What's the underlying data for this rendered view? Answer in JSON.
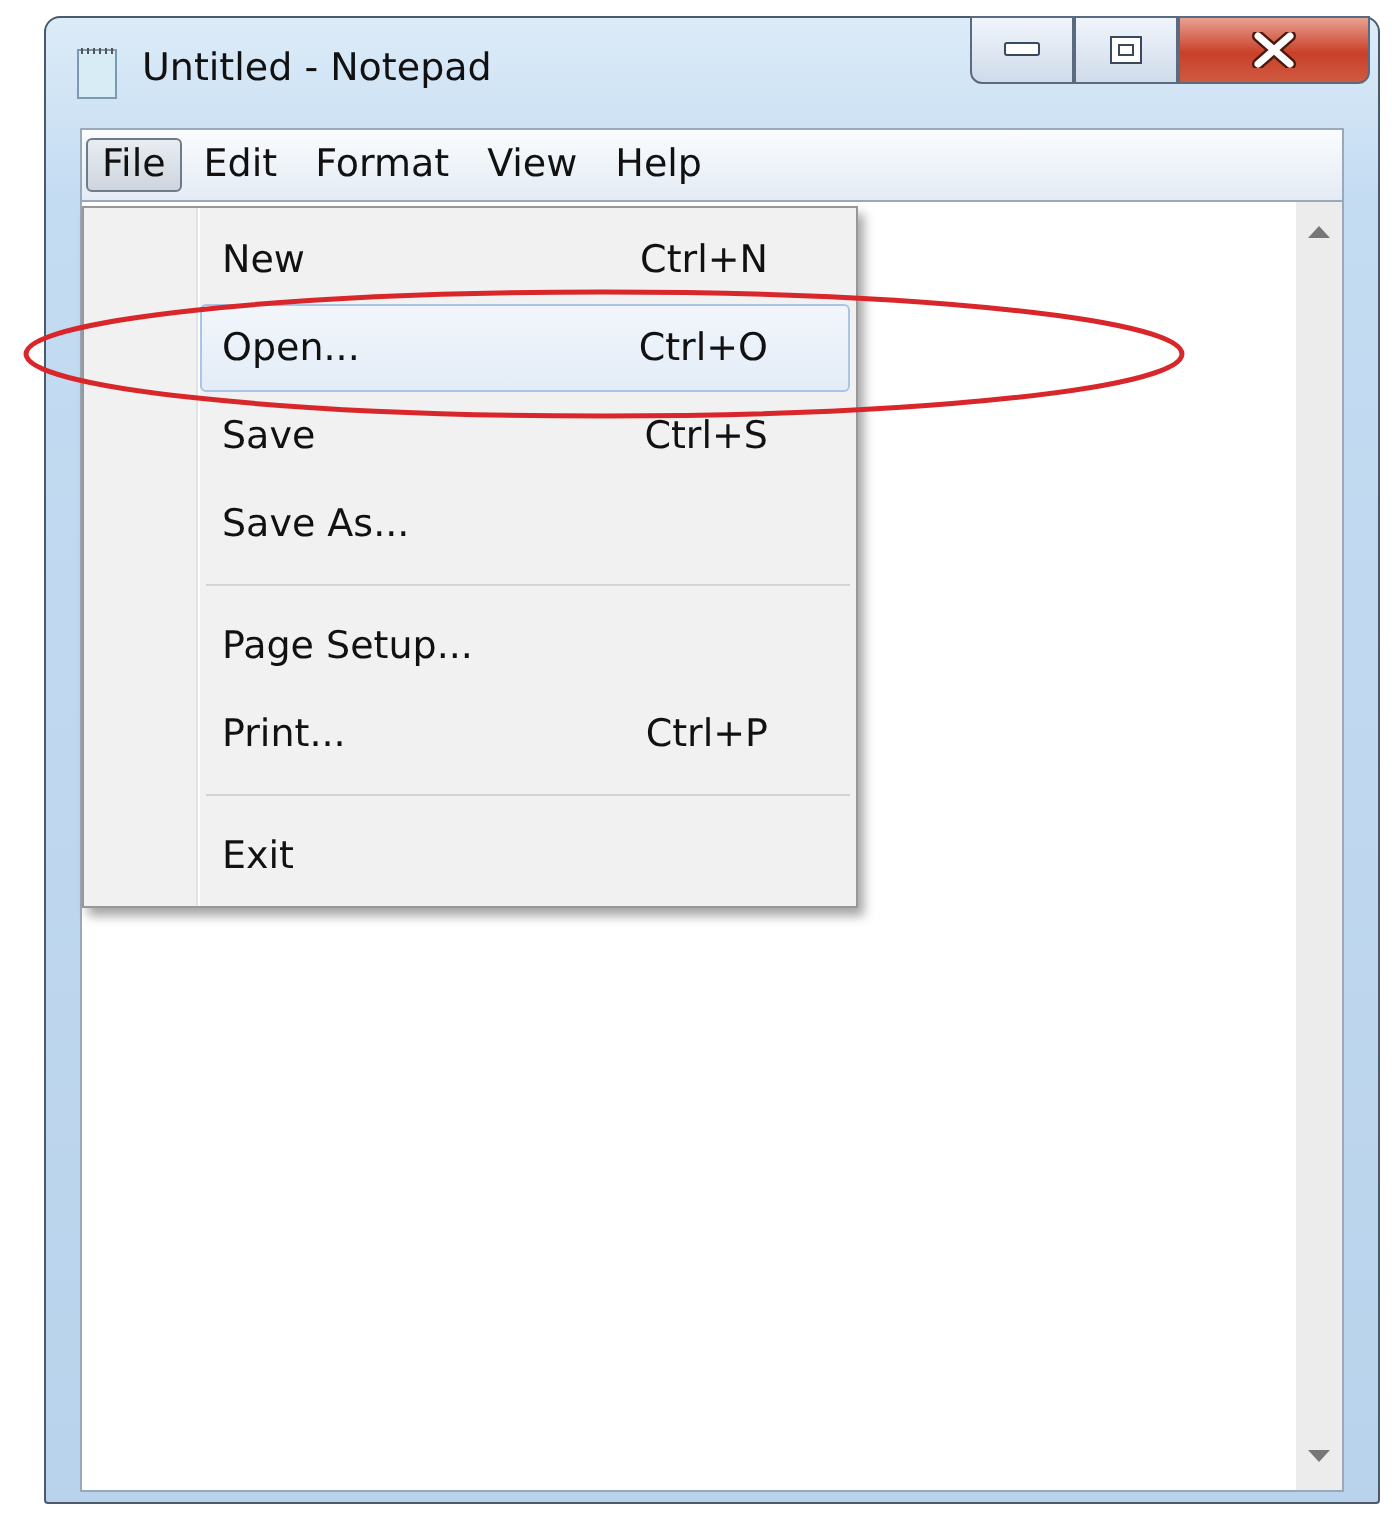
{
  "window": {
    "title": "Untitled - Notepad"
  },
  "menu_bar": [
    {
      "label": "File",
      "selected": true
    },
    {
      "label": "Edit",
      "selected": false
    },
    {
      "label": "Format",
      "selected": false
    },
    {
      "label": "View",
      "selected": false
    },
    {
      "label": "Help",
      "selected": false
    }
  ],
  "file_menu": [
    {
      "kind": "item",
      "label": "New",
      "shortcut": "Ctrl+N",
      "selected": false
    },
    {
      "kind": "item",
      "label": "Open...",
      "shortcut": "Ctrl+O",
      "selected": true
    },
    {
      "kind": "item",
      "label": "Save",
      "shortcut": "Ctrl+S",
      "selected": false
    },
    {
      "kind": "item",
      "label": "Save As...",
      "selected": false
    },
    {
      "kind": "separator"
    },
    {
      "kind": "item",
      "label": "Page Setup...",
      "selected": false
    },
    {
      "kind": "item",
      "label": "Print...",
      "shortcut": "Ctrl+P",
      "selected": false
    },
    {
      "kind": "separator"
    },
    {
      "kind": "item",
      "label": "Exit",
      "selected": false
    }
  ]
}
